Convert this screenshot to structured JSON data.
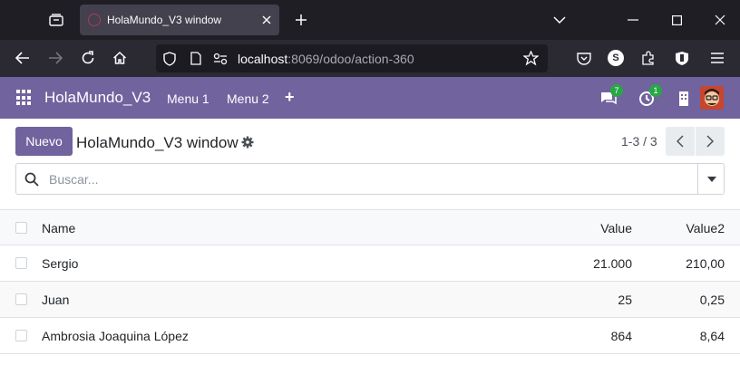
{
  "browser": {
    "tab_title": "HolaMundo_V3 window",
    "url_host": "localhost",
    "url_path": ":8069/odoo/action-360"
  },
  "odoo": {
    "brand": "HolaMundo_V3",
    "menus": [
      "Menu 1",
      "Menu 2"
    ],
    "plus_label": "+",
    "messages_count": "7",
    "activities_count": "1",
    "accent_color": "#71639e"
  },
  "control_panel": {
    "new_button": "Nuevo",
    "title": "HolaMundo_V3 window",
    "pager": "1-3 / 3"
  },
  "search": {
    "placeholder": "Buscar..."
  },
  "list": {
    "columns": [
      "Name",
      "Value",
      "Value2"
    ],
    "rows": [
      {
        "name": "Sergio",
        "value": "21.000",
        "value2": "210,00"
      },
      {
        "name": "Juan",
        "value": "25",
        "value2": "0,25"
      },
      {
        "name": "Ambrosia Joaquina López",
        "value": "864",
        "value2": "8,64"
      }
    ]
  }
}
